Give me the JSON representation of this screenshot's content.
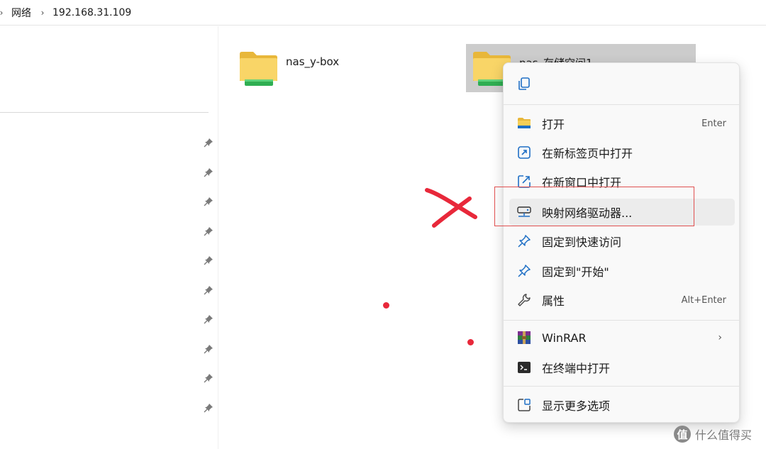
{
  "addressbar": {
    "crumbs": [
      "网络",
      "192.168.31.109"
    ]
  },
  "folders": [
    {
      "name": "nas_y-box",
      "selected": false
    },
    {
      "name": "nas_存储空间1",
      "selected": true
    }
  ],
  "context_menu": {
    "top_actions": [
      {
        "icon": "copy-icon"
      }
    ],
    "groups": [
      [
        {
          "label": "打开",
          "shortcut": "Enter",
          "icon": "folder-icon"
        },
        {
          "label": "在新标签页中打开",
          "icon": "open-new-tab-icon"
        },
        {
          "label": "在新窗口中打开",
          "icon": "open-new-window-icon"
        },
        {
          "label": "映射网络驱动器...",
          "icon": "map-network-drive-icon"
        },
        {
          "label": "固定到快速访问",
          "icon": "pin-icon"
        },
        {
          "label": "固定到\"开始\"",
          "icon": "pin-icon"
        },
        {
          "label": "属性",
          "shortcut": "Alt+Enter",
          "icon": "wrench-icon"
        }
      ],
      [
        {
          "label": "WinRAR",
          "icon": "winrar-icon",
          "submenu": true
        },
        {
          "label": "在终端中打开",
          "icon": "terminal-icon"
        }
      ],
      [
        {
          "label": "显示更多选项",
          "icon": "more-options-icon"
        }
      ]
    ]
  },
  "annotation": {
    "color": "#e8283a"
  },
  "watermark": {
    "text": "什么值得买",
    "icon_glyph": "值"
  },
  "colors": {
    "accent": "#0067c0",
    "selection": "#cccccc",
    "menu_bg": "#f9f9f9"
  }
}
